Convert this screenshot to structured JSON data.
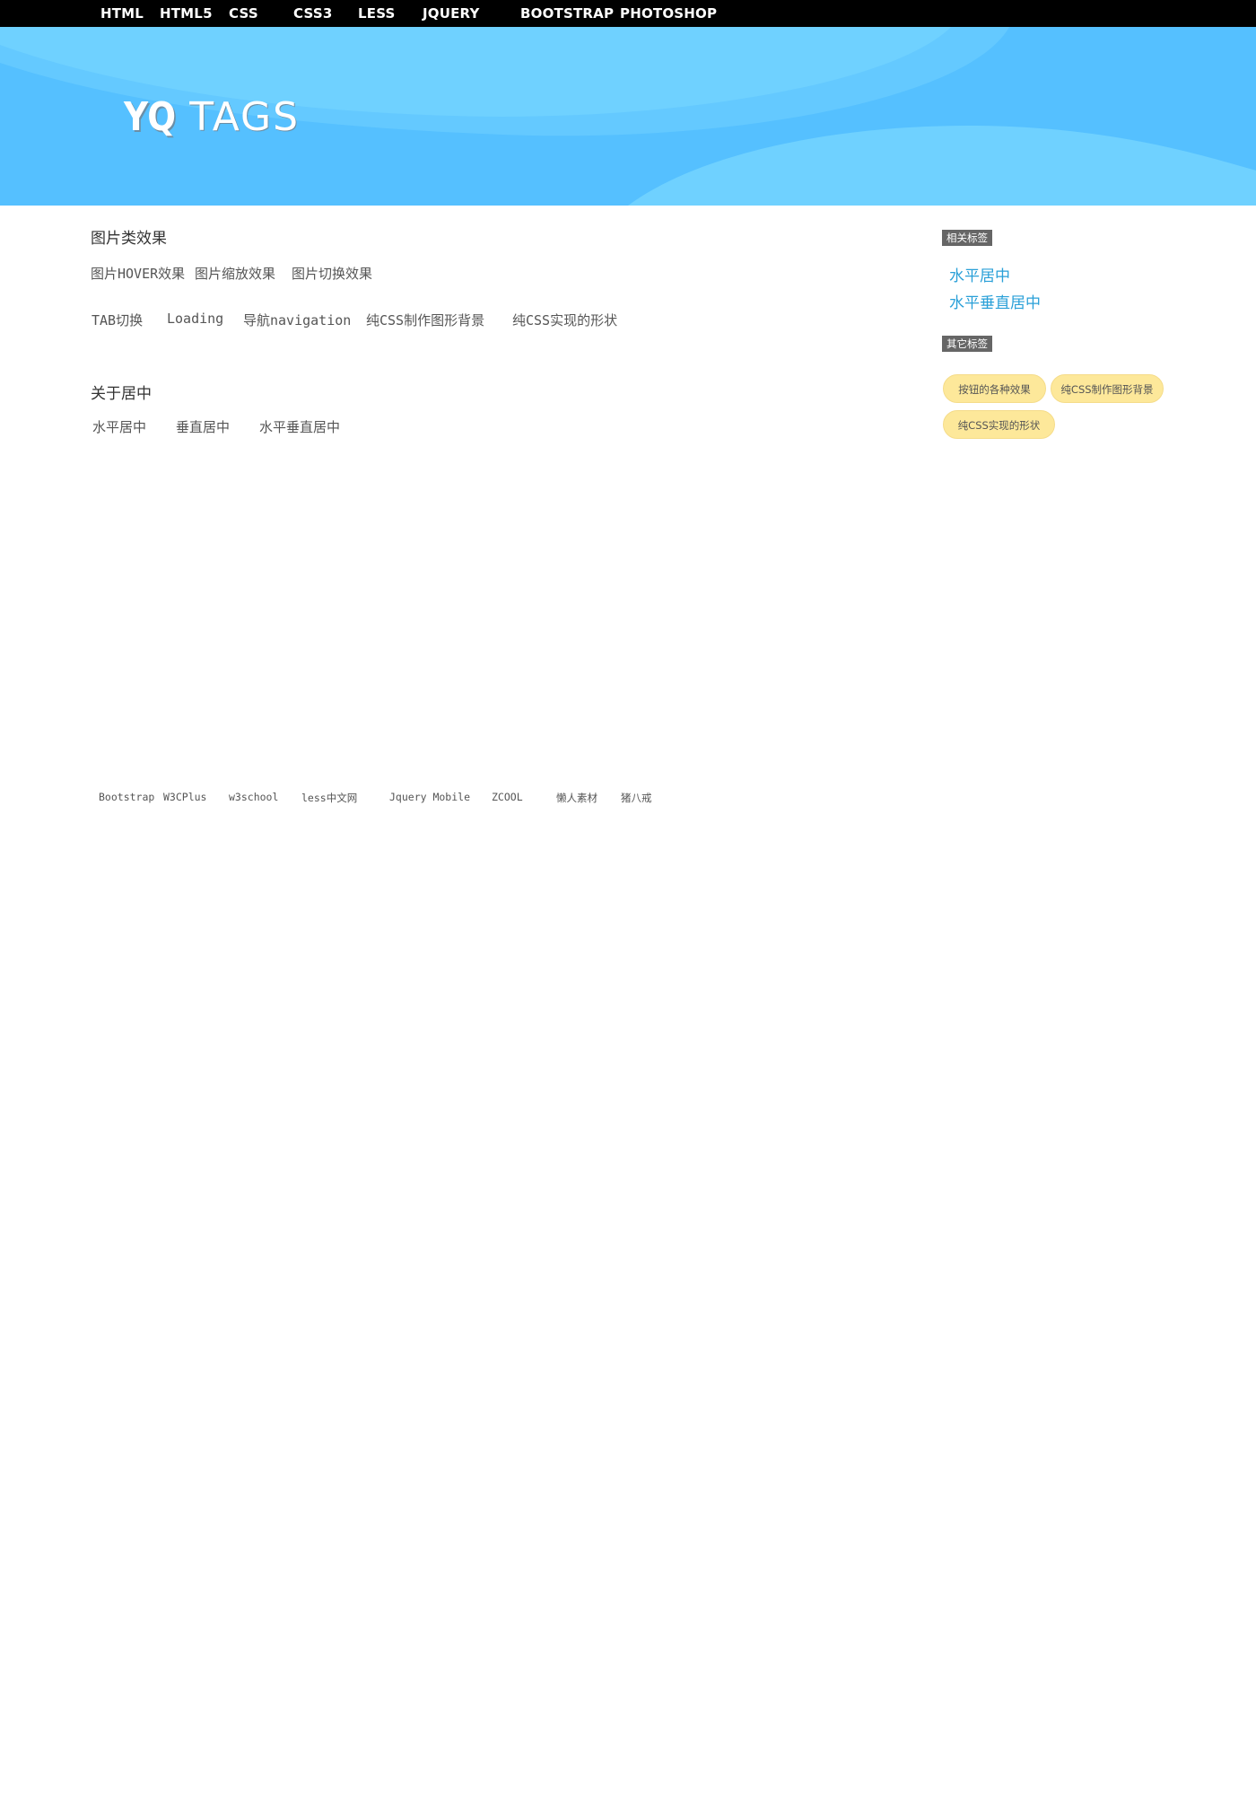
{
  "nav": {
    "items": [
      {
        "label": "HTML"
      },
      {
        "label": "HTML5"
      },
      {
        "label": "CSS"
      },
      {
        "label": "CSS3"
      },
      {
        "label": "LESS"
      },
      {
        "label": "JQUERY"
      },
      {
        "label": "BOOTSTRAP"
      },
      {
        "label": "PHOTOSHOP"
      }
    ]
  },
  "banner": {
    "logo_yq": "YQ",
    "logo_tags": "TAGS",
    "colors": {
      "base": "#55c0ff",
      "light": "#6fd1ff",
      "wave": "#64c9ff"
    }
  },
  "main": {
    "section1": {
      "title": "图片类效果",
      "row1": [
        "图片HOVER效果",
        "图片缩放效果",
        "图片切换效果"
      ],
      "row2": [
        "TAB切换",
        "Loading",
        "导航navigation",
        "纯CSS制作图形背景",
        "纯CSS实现的形状"
      ]
    },
    "section2": {
      "title": "关于居中",
      "links": [
        "水平居中",
        "垂直居中",
        "水平垂直居中"
      ]
    },
    "friend_links": [
      "Bootstrap",
      "W3CPlus",
      "w3school",
      "less中文网",
      "Jquery Mobile",
      "ZCOOL",
      "懒人素材",
      "猪八戒"
    ]
  },
  "sidebar": {
    "related": {
      "heading": "相关标签",
      "links": [
        "水平居中",
        "水平垂直居中"
      ]
    },
    "other": {
      "heading": "其它标签",
      "pills": [
        "按钮的各种效果",
        "纯CSS制作图形背景",
        "纯CSS实现的形状"
      ]
    },
    "colors": {
      "link": "#2aa0d8",
      "pill": "#fde89a",
      "heading_bg": "#666666"
    }
  }
}
